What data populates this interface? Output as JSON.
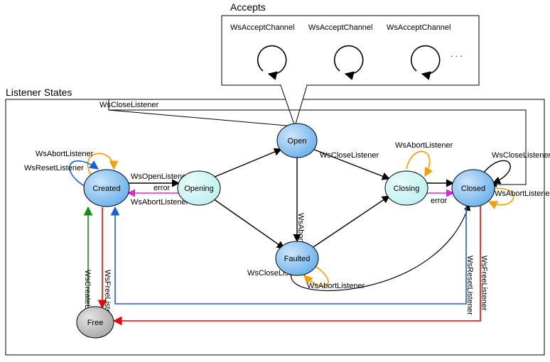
{
  "diagram": {
    "title": "Listener States",
    "accepts_title": "Accepts",
    "states": {
      "created": "Created",
      "opening": "Opening",
      "open": "Open",
      "closing": "Closing",
      "closed": "Closed",
      "faulted": "Faulted",
      "free": "Free"
    },
    "labels": {
      "ws_close_listener": "WsCloseListener",
      "ws_open_listener": "WsOpenListener",
      "ws_abort_listener": "WsAbortListener",
      "ws_reset_listener": "WsResetListener",
      "ws_create_listener": "WsCreateListener",
      "ws_free_listener": "WsFreeListener",
      "ws_accept_channel": "WsAcceptChannel",
      "error": "error",
      "ellipsis": ". . ."
    }
  },
  "chart_data": {
    "type": "state-diagram",
    "title": "Listener States",
    "nodes": [
      {
        "id": "Free",
        "kind": "pseudo"
      },
      {
        "id": "Created",
        "kind": "state"
      },
      {
        "id": "Opening",
        "kind": "state"
      },
      {
        "id": "Open",
        "kind": "state"
      },
      {
        "id": "Closing",
        "kind": "state"
      },
      {
        "id": "Closed",
        "kind": "state"
      },
      {
        "id": "Faulted",
        "kind": "state"
      }
    ],
    "edges": [
      {
        "from": "Free",
        "to": "Created",
        "label": "WsCreateListener",
        "color": "green"
      },
      {
        "from": "Created",
        "to": "Free",
        "label": "WsFreeListener",
        "color": "red"
      },
      {
        "from": "Created",
        "to": "Created",
        "label": "WsAbortListener",
        "color": "orange",
        "self": true
      },
      {
        "from": "Created",
        "to": "Created",
        "label": "WsResetListener",
        "color": "blue",
        "self": true
      },
      {
        "from": "Created",
        "to": "Opening",
        "label": "WsOpenListener",
        "color": "black"
      },
      {
        "from": "Opening",
        "to": "Created",
        "label": "error",
        "color": "magenta"
      },
      {
        "from": "Opening",
        "to": "Open",
        "label": "",
        "color": "black"
      },
      {
        "from": "Opening",
        "to": "Faulted",
        "label": "",
        "color": "black"
      },
      {
        "from": "Open",
        "to": "Closing",
        "label": "WsCloseListener",
        "color": "black"
      },
      {
        "from": "Open",
        "to": "Faulted",
        "label": "WsAbortListener",
        "color": "black"
      },
      {
        "from": "Open",
        "to": "Closed",
        "label": "WsCloseListener",
        "color": "black",
        "via": "top"
      },
      {
        "from": "Closing",
        "to": "Closed",
        "label": "",
        "color": "black"
      },
      {
        "from": "Closing",
        "to": "Closed",
        "label": "error",
        "color": "magenta"
      },
      {
        "from": "Closing",
        "to": "Closing",
        "label": "WsAbortListener",
        "color": "orange",
        "self": true
      },
      {
        "from": "Faulted",
        "to": "Closing",
        "label": "",
        "color": "black"
      },
      {
        "from": "Faulted",
        "to": "Faulted",
        "label": "WsAbortListener",
        "color": "orange",
        "self": true
      },
      {
        "from": "Faulted",
        "to": "Closed",
        "label": "WsCloseListener",
        "color": "black"
      },
      {
        "from": "Closed",
        "to": "Created",
        "label": "WsResetListener",
        "color": "blue"
      },
      {
        "from": "Closed",
        "to": "Free",
        "label": "WsFreeListener",
        "color": "red"
      },
      {
        "from": "Closed",
        "to": "Closed",
        "label": "WsCloseListener",
        "color": "black",
        "self": true
      },
      {
        "from": "Closed",
        "to": "Closed",
        "label": "WsAbortListener",
        "color": "orange",
        "self": true
      }
    ],
    "accepts_box": {
      "attached_to": "Open",
      "items": [
        "WsAcceptChannel",
        "WsAcceptChannel",
        "WsAcceptChannel",
        "..."
      ],
      "self_loop": true
    }
  }
}
